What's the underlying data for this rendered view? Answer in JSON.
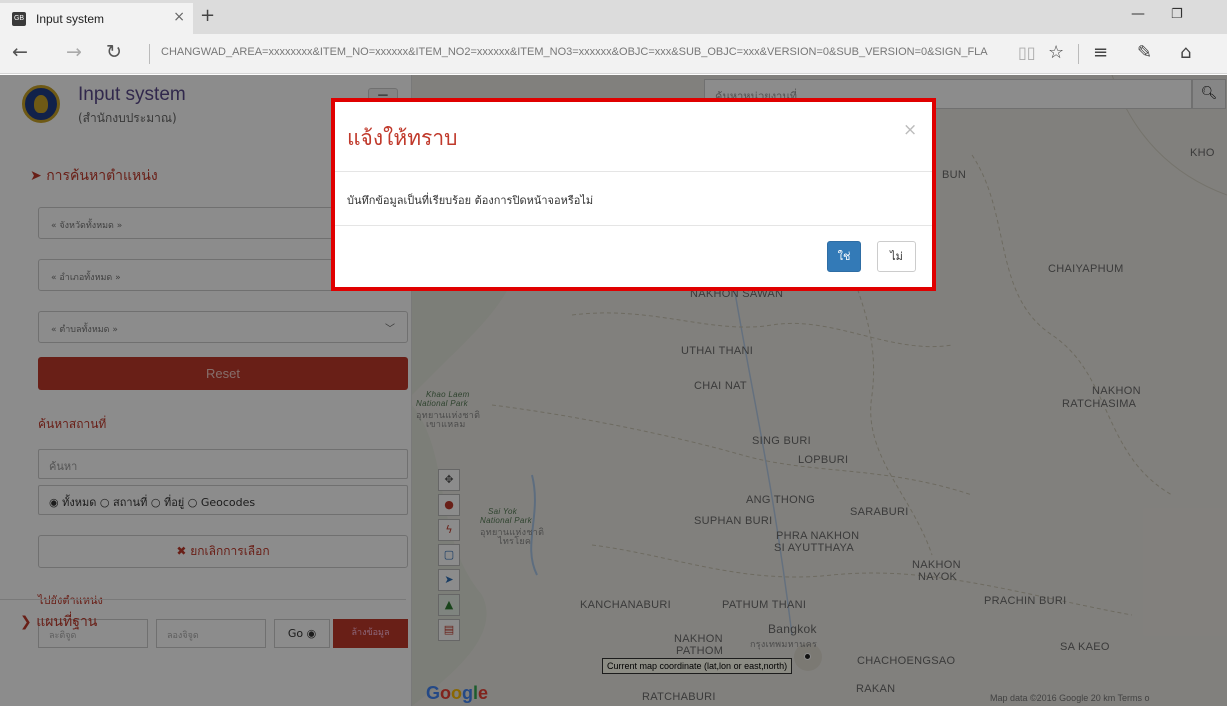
{
  "browser": {
    "tab_title": "Input system",
    "tab_close": "×",
    "new_tab": "+",
    "url": "CHANGWAD_AREA=xxxxxxxx&ITEM_NO=xxxxxx&ITEM_NO2=xxxxxx&ITEM_NO3=xxxxxx&OBJC=xxx&SUB_OBJC=xxx&VERSION=0&SUB_VERSION=0&SIGN_FLA",
    "icons": [
      "back-icon",
      "forward-icon",
      "refresh-icon",
      "reading-view-icon",
      "favorite-star-icon",
      "hub-icon",
      "web-note-icon",
      "share-icon"
    ]
  },
  "sidebar": {
    "app_title": "Input system",
    "app_subtitle": "(สำนักงบประมาณ)",
    "section_locate": "การค้นหาตำแหน่ง",
    "select_province": "« จังหวัดทั้งหมด »",
    "select_amphoe": "« อำเภอทั้งหมด »",
    "select_tambon": "« ตำบลทั้งหมด »",
    "reset_label": "Reset",
    "section_place": "ค้นหาสถานที่",
    "place_placeholder": "ค้นหา",
    "radio_all": "ทั้งหมด",
    "radio_place": "สถานที่",
    "radio_address": "ที่อยู่",
    "radio_geocodes": "Geocodes",
    "cancel_select_label": "ยกเลิกการเลือก",
    "section_goto": "ไปยังตำแหน่ง",
    "lat_placeholder": "ละติจูด",
    "lon_placeholder": "ลองจิจูด",
    "go_label": "Go",
    "clear_label": "ล้างข้อมูล",
    "section_basemap": "แผนที่ฐาน"
  },
  "map": {
    "search_placeholder": "ค้นหาหน่วยงานที่",
    "labels": {
      "khon": "KHO",
      "bun": "BUN",
      "chaiyaphum": "CHAIYAPHUM",
      "nakhon_sawan": "NAKHON SAWAN",
      "uthai_thani": "UTHAI THANI",
      "chai_nat": "CHAI NAT",
      "khao_laem": "Khao Laem",
      "khao_laem2": "National Park",
      "khao_laem_th": "อุทยานแห่งชาติ",
      "khao_laem_th2": "เขาแหลม",
      "nakhon_ratchasima1": "NAKHON",
      "nakhon_ratchasima2": "RATCHASIMA",
      "sing_buri": "SING BURI",
      "lopburi": "LOPBURI",
      "ang_thong": "ANG THONG",
      "saraburi": "SARABURI",
      "sai_yok1": "Sai Yok",
      "sai_yok2": "National Park",
      "sai_yok_th1": "อุทยานแห่งชาติ",
      "sai_yok_th2": "ไทรโยค",
      "suphan_buri": "SUPHAN BURI",
      "ayutthaya1": "PHRA NAKHON",
      "ayutthaya2": "SI AYUTTHAYA",
      "nakhon_nayok1": "NAKHON",
      "nakhon_nayok2": "NAYOK",
      "kanchanaburi": "KANCHANABURI",
      "pathum_thani": "PATHUM THANI",
      "prachin_buri": "PRACHIN BURI",
      "nakhon_pathom1": "NAKHON",
      "nakhon_pathom2": "PATHOM",
      "bangkok": "Bangkok",
      "bangkok_th": "กรุงเทพมหานคร",
      "chachoengsao": "CHACHOENGSAO",
      "sa_kaeo": "SA KAEO",
      "ratchaburi": "RATCHABURI",
      "rakan": "RAKAN"
    },
    "google": "Google",
    "coord_tooltip": "Current map coordinate (lat,lon or east,north)",
    "attribution": "Map data ©2016 Google   20 km         Terms o",
    "tool_icons": [
      "move-icon",
      "pin-icon",
      "line-icon",
      "polygon-icon",
      "locate-icon",
      "layers-icon",
      "trash-icon"
    ]
  },
  "modal": {
    "title": "แจ้งให้ทราบ",
    "close": "×",
    "message": "บันทึกข้อมูลเป็นที่เรียบร้อย ต้องการปิดหน้าจอหรือไม่",
    "yes_label": "ใช่",
    "no_label": "ไม่"
  },
  "colors": {
    "accent_red": "#c0392b",
    "highlight_border": "#e00000",
    "primary_blue": "#337ab7"
  }
}
